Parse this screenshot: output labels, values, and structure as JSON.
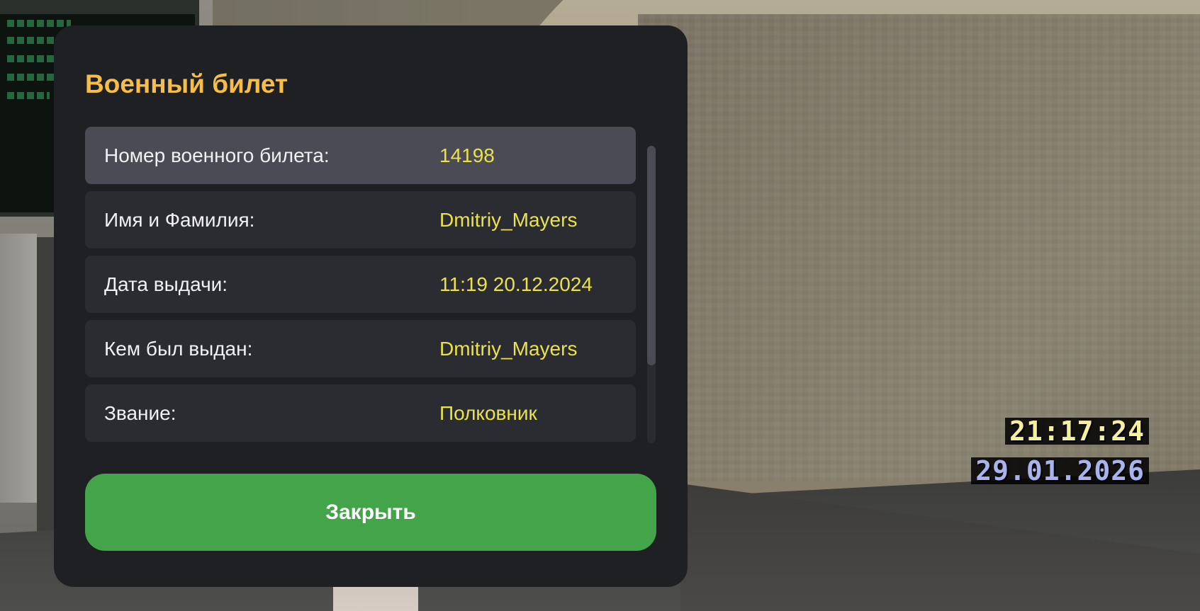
{
  "dialog": {
    "title": "Военный билет",
    "rows": [
      {
        "label": "Номер военного билета:",
        "value": "14198",
        "selected": true
      },
      {
        "label": "Имя и Фамилия:",
        "value": "Dmitriy_Mayers",
        "selected": false
      },
      {
        "label": "Дата выдачи:",
        "value": "11:19 20.12.2024",
        "selected": false
      },
      {
        "label": "Кем был выдан:",
        "value": "Dmitriy_Mayers",
        "selected": false
      },
      {
        "label": "Звание:",
        "value": "Полковник",
        "selected": false
      }
    ],
    "close_label": "Закрыть"
  },
  "hud": {
    "time": "21:17:24",
    "date": "29.01.2026"
  },
  "colors": {
    "dialog_bg": "#1f2024",
    "title": "#f7bd45",
    "row_bg": "#2b2c31",
    "row_selected_bg": "#4a4b55",
    "value_text": "#e9e24b",
    "close_button": "#44a449",
    "hud_time": "#f4f0a0",
    "hud_date": "#a9b4ee"
  }
}
